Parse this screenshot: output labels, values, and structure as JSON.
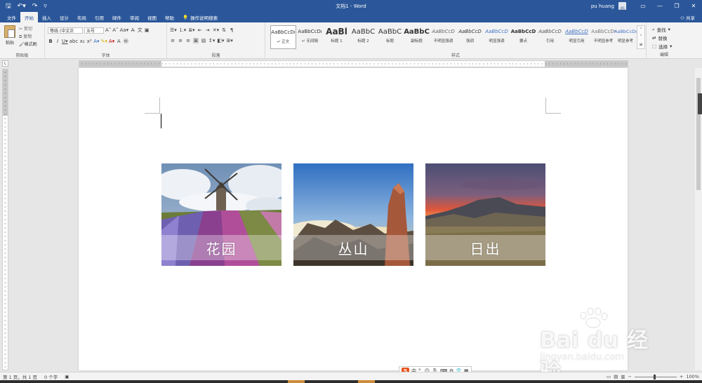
{
  "titlebar": {
    "doc_title": "文档1 - Word",
    "user_name": "pu huang"
  },
  "tabs": [
    "文件",
    "开始",
    "插入",
    "设计",
    "布局",
    "引用",
    "邮件",
    "审阅",
    "视图",
    "帮助"
  ],
  "tell_me": "操作说明搜索",
  "share": "共享",
  "ribbon": {
    "clipboard": {
      "paste": "粘贴",
      "cut": "剪切",
      "copy": "复制",
      "format_painter": "格式刷",
      "label": "剪贴板"
    },
    "font": {
      "family": "等线 (中文正",
      "size": "五号",
      "label": "字体"
    },
    "paragraph": {
      "label": "段落"
    },
    "styles": {
      "label": "样式",
      "items": [
        {
          "preview": "AaBbCcDı",
          "name": "↵ 正文"
        },
        {
          "preview": "AaBbCcDı",
          "name": "↵ 无间隔"
        },
        {
          "preview": "AaBl",
          "name": "标题 1"
        },
        {
          "preview": "AaBbC",
          "name": "标题 2"
        },
        {
          "preview": "AaBbC",
          "name": "标题"
        },
        {
          "preview": "AaBbC",
          "name": "副标题"
        },
        {
          "preview": "AaBbCcD",
          "name": "不明显强调"
        },
        {
          "preview": "AaBbCcD",
          "name": "强调"
        },
        {
          "preview": "AaBbCcD",
          "name": "明显强调"
        },
        {
          "preview": "AaBbCcD",
          "name": "要点"
        },
        {
          "preview": "AaBbCcD",
          "name": "引用"
        },
        {
          "preview": "AaBbCcD",
          "name": "明显引用"
        },
        {
          "preview": "AaBbCcDı",
          "name": "不明显参考"
        },
        {
          "preview": "AaBbCcDı",
          "name": "明显参考"
        }
      ]
    },
    "editing": {
      "find": "查找",
      "replace": "替换",
      "select": "选择",
      "label": "编辑"
    }
  },
  "photos": [
    {
      "caption": "花园"
    },
    {
      "caption": "丛山"
    },
    {
      "caption": "日出"
    }
  ],
  "watermark": {
    "main": "Bai du 经验",
    "sub": "jingyan.baidu.com"
  },
  "status": {
    "page": "第 1 页，共 1 页",
    "words": "0 个字",
    "zoom": "100%"
  },
  "ime": {
    "logo": "S",
    "mode": "中"
  }
}
